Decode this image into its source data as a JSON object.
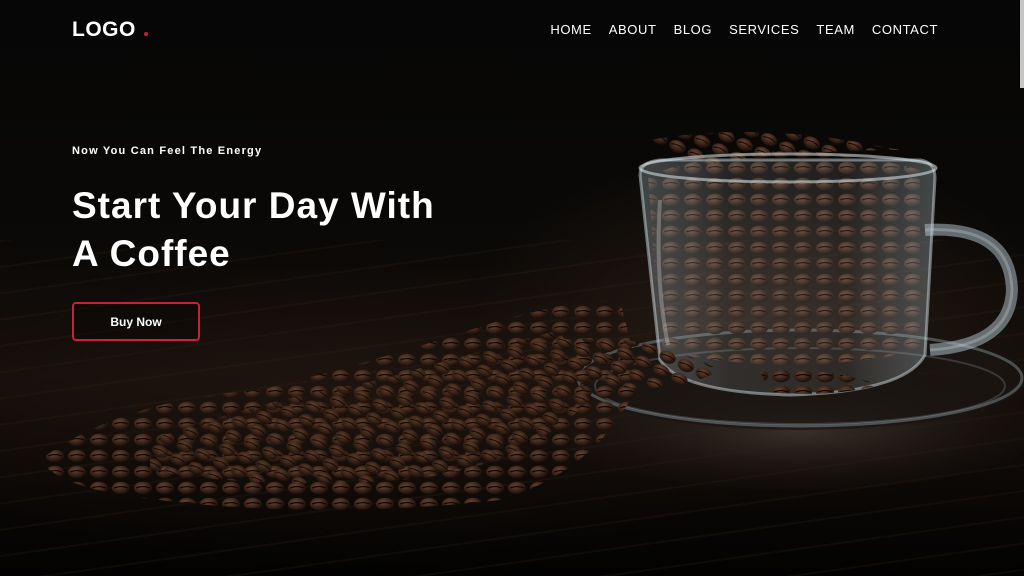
{
  "header": {
    "logo_text": "LOGO",
    "logo_dot_color": "#d3193b",
    "nav": [
      {
        "label": "HOME"
      },
      {
        "label": "ABOUT"
      },
      {
        "label": "BLOG"
      },
      {
        "label": "SERVICES"
      },
      {
        "label": "TEAM"
      },
      {
        "label": "CONTACT"
      }
    ]
  },
  "hero": {
    "tagline": "Now You Can Feel The Energy",
    "headline_line1": "Start Your Day With",
    "headline_line2": "A Coffee",
    "button_label": "Buy Now",
    "button_border_color": "#c8213e",
    "background_image": "coffee-beans-glass-cup-photo"
  }
}
